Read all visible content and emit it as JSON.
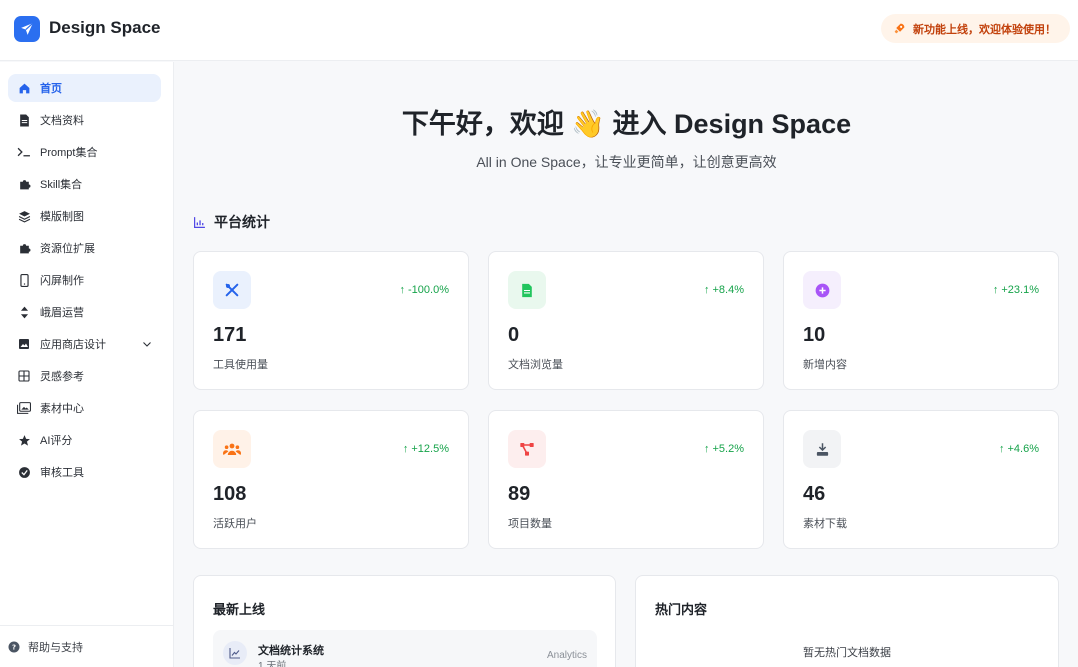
{
  "header": {
    "brand": "Design Space",
    "announcement": "新功能上线，欢迎体验使用！"
  },
  "sidebar": {
    "items": [
      {
        "label": "首页",
        "icon": "home-icon",
        "active": true
      },
      {
        "label": "文档资料",
        "icon": "document-icon"
      },
      {
        "label": "Prompt集合",
        "icon": "terminal-icon"
      },
      {
        "label": "Skill集合",
        "icon": "puzzle-icon"
      },
      {
        "label": "模版制图",
        "icon": "layers-icon"
      },
      {
        "label": "资源位扩展",
        "icon": "puzzle-icon"
      },
      {
        "label": "闪屏制作",
        "icon": "phone-icon"
      },
      {
        "label": "峨眉运营",
        "icon": "sort-icon"
      },
      {
        "label": "应用商店设计",
        "icon": "image-icon"
      },
      {
        "label": "灵感参考",
        "icon": "grid-icon"
      },
      {
        "label": "素材中心",
        "icon": "gallery-icon"
      },
      {
        "label": "AI评分",
        "icon": "star-icon"
      },
      {
        "label": "审核工具",
        "icon": "check-circle-icon"
      }
    ],
    "footer": "帮助与支持"
  },
  "hero": {
    "title_pre": "下午好，欢迎",
    "emoji": "👋",
    "title_post": "进入 Design Space",
    "subtitle": "All in One Space，让专业更简单，让创意更高效"
  },
  "stats": {
    "title": "平台统计",
    "cards": [
      {
        "value": "171",
        "label": "工具使用量",
        "trend": "-100.0%",
        "icon": "tools-icon",
        "bg": "#eaf1fd",
        "color": "#2563eb"
      },
      {
        "value": "0",
        "label": "文档浏览量",
        "trend": "+8.4%",
        "icon": "file-icon",
        "bg": "#e9f8ee",
        "color": "#22c55e"
      },
      {
        "value": "10",
        "label": "新增内容",
        "trend": "+23.1%",
        "icon": "plus-circle-icon",
        "bg": "#f5effd",
        "color": "#a855f7"
      },
      {
        "value": "108",
        "label": "活跃用户",
        "trend": "+12.5%",
        "icon": "users-icon",
        "bg": "#fff2e8",
        "color": "#f97316"
      },
      {
        "value": "89",
        "label": "项目数量",
        "trend": "+5.2%",
        "icon": "nodes-icon",
        "bg": "#fdeeee",
        "color": "#ef4444"
      },
      {
        "value": "46",
        "label": "素材下载",
        "trend": "+4.6%",
        "icon": "download-icon",
        "bg": "#f2f3f5",
        "color": "#4b5563"
      }
    ]
  },
  "latest": {
    "title": "最新上线",
    "item": {
      "title": "文档统计系统",
      "time": "1 天前",
      "tag": "Analytics"
    }
  },
  "hot": {
    "title": "热门内容",
    "empty": "暂无热门文档数据"
  },
  "colors": {
    "accent": "#2563eb",
    "trend_up": "#16a34a"
  }
}
